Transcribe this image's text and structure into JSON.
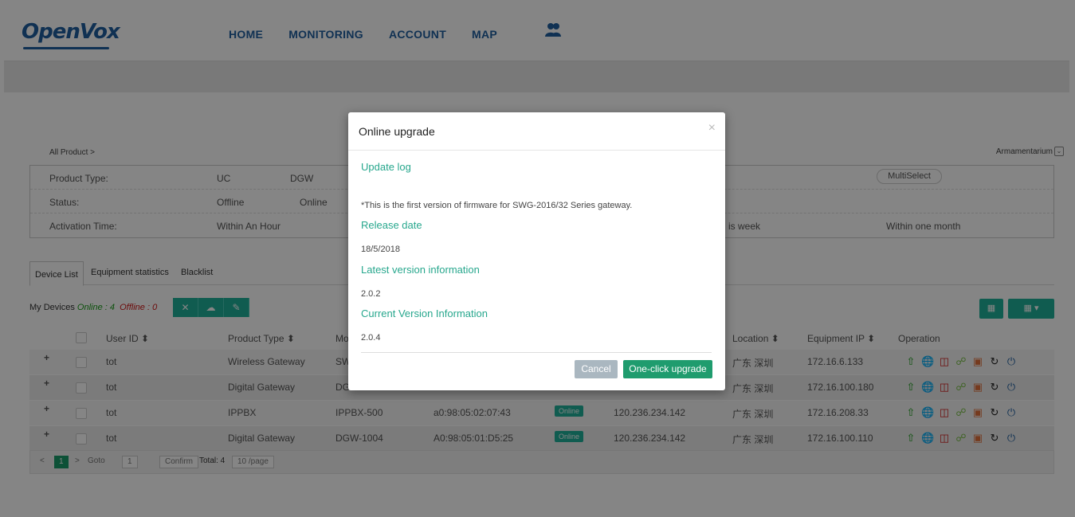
{
  "brand": "OpenVox",
  "nav": [
    "HOME",
    "MONITORING",
    "ACCOUNT",
    "MAP"
  ],
  "breadcrumb": "All Product >",
  "armament_label": "Armamentarium",
  "filters": {
    "product_type_label": "Product Type:",
    "product_type_opts": [
      "UC",
      "DGW"
    ],
    "status_label": "Status:",
    "status_opts": [
      "Offline",
      "Online"
    ],
    "activation_label": "Activation Time:",
    "activation_opts": [
      "Within An Hour",
      "is week",
      "Within one month"
    ],
    "multiselect": "MultiSelect"
  },
  "tabs": [
    "Device List",
    "Equipment statistics",
    "Blacklist"
  ],
  "mydevices": {
    "prefix": "My Devices",
    "online": "Online : 4",
    "offline": "Offline : 0"
  },
  "columns": {
    "user_id": "User ID ⬍",
    "product_type": "Product Type ⬍",
    "model": "Mo",
    "location": "Location ⬍",
    "equipment_ip": "Equipment IP ⬍",
    "operation": "Operation"
  },
  "rows": [
    {
      "user": "tot",
      "type": "Wireless Gateway",
      "model": "SW",
      "mac": "",
      "status": "",
      "ip_pub": "",
      "loc": "广东 深圳",
      "ip": "172.16.6.133"
    },
    {
      "user": "tot",
      "type": "Digital Gateway",
      "model": "DG",
      "mac": "",
      "status": "",
      "ip_pub": "",
      "loc": "广东 深圳",
      "ip": "172.16.100.180"
    },
    {
      "user": "tot",
      "type": "IPPBX",
      "model": "IPPBX-500",
      "mac": "a0:98:05:02:07:43",
      "status": "Online",
      "ip_pub": "120.236.234.142",
      "loc": "广东 深圳",
      "ip": "172.16.208.33"
    },
    {
      "user": "tot",
      "type": "Digital Gateway",
      "model": "DGW-1004",
      "mac": "A0:98:05:01:D5:25",
      "status": "Online",
      "ip_pub": "120.236.234.142",
      "loc": "广东 深圳",
      "ip": "172.16.100.110"
    }
  ],
  "pager": {
    "current": "1",
    "goto_label": "Goto",
    "goto_value": "1",
    "confirm": "Confirm",
    "total": "Total: 4",
    "per_page": "10 /page"
  },
  "modal": {
    "title": "Online upgrade",
    "close": "×",
    "update_log_h": "Update log",
    "update_log_t": "*This is the first version of firmware for SWG-2016/32 Series gateway.",
    "release_h": "Release date",
    "release_t": "18/5/2018",
    "latest_h": "Latest version information",
    "latest_t": "2.0.2",
    "current_h": "Current Version Information",
    "current_t": "2.0.4",
    "cancel": "Cancel",
    "upgrade": "One-click upgrade"
  },
  "colors": {
    "accent": "#20b09a",
    "brand": "#1f5f9f",
    "online": "#1a9c1a",
    "offline": "#d01818"
  }
}
